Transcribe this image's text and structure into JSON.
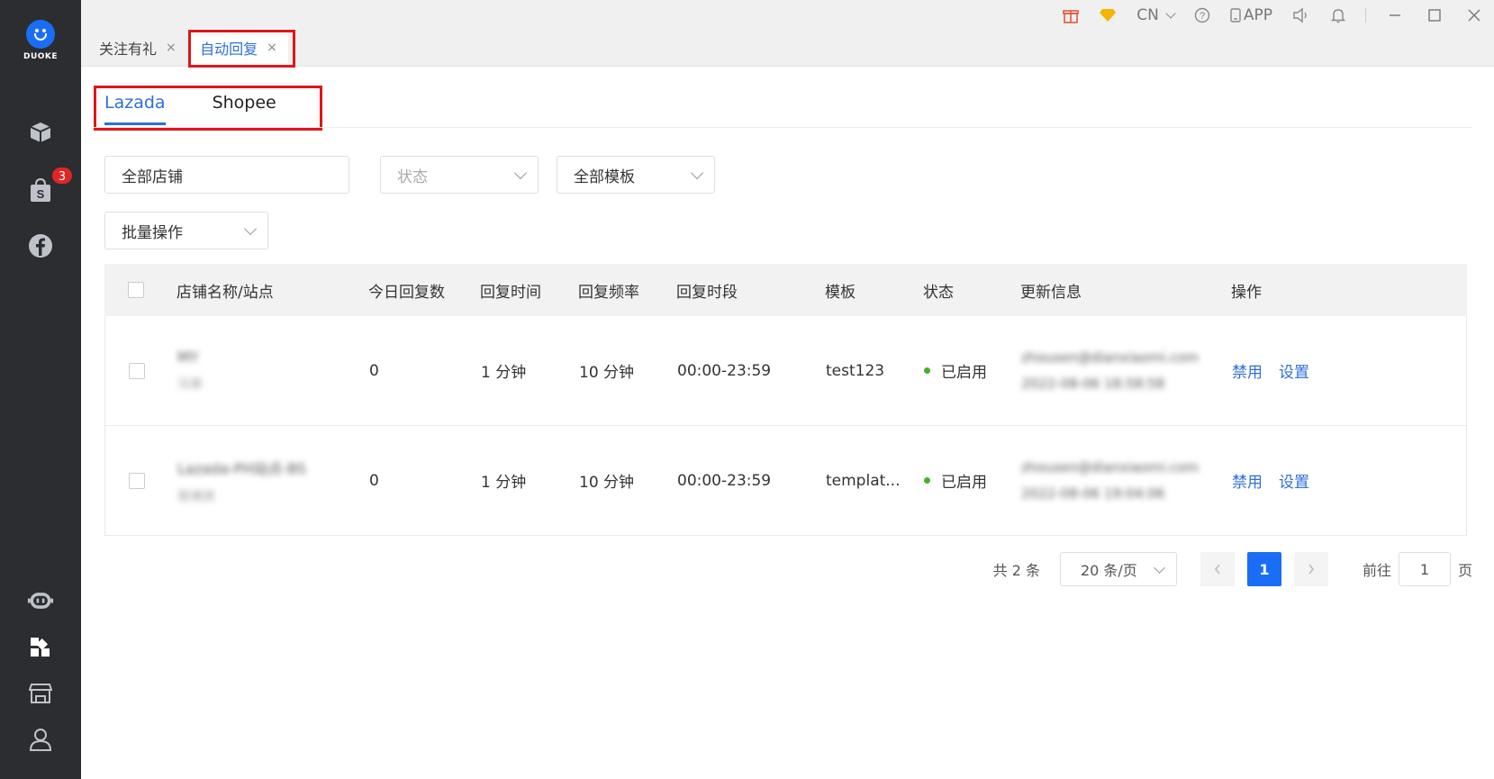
{
  "sidebar": {
    "logo_text": "DUOKE",
    "badge_count": "3",
    "icons": [
      "box-icon",
      "shopping-bag-icon",
      "facebook-icon",
      "robot-icon",
      "apps-icon",
      "store-icon",
      "user-icon"
    ]
  },
  "tabs": [
    {
      "label": "关注有礼",
      "close": "×"
    },
    {
      "label": "自动回复",
      "close": "×"
    }
  ],
  "topbar": {
    "language": "CN",
    "app_label": "APP"
  },
  "platform_tabs": [
    "Lazada",
    "Shopee"
  ],
  "filters": {
    "shop": "全部店铺",
    "status_placeholder": "状态",
    "template": "全部模板",
    "batch": "批量操作"
  },
  "table": {
    "headers": [
      "店铺名称/站点",
      "今日回复数",
      "回复时间",
      "回复频率",
      "回复时段",
      "模板",
      "状态",
      "更新信息",
      "操作"
    ],
    "rows": [
      {
        "shop_name": "MY",
        "shop_site": "马来",
        "today": "0",
        "reply_time": "1 分钟",
        "frequency": "10 分钟",
        "period": "00:00-23:59",
        "template": "test123",
        "status": "已启用",
        "update_user": "zhousen@dianxiaomi.com",
        "update_time": "2022-08-06 18:58:58",
        "op_disable": "禁用",
        "op_settings": "设置"
      },
      {
        "shop_name": "Lazada-PH站点-BS",
        "shop_site": "菲律宾",
        "today": "0",
        "reply_time": "1 分钟",
        "frequency": "10 分钟",
        "period": "00:00-23:59",
        "template": "templat...",
        "status": "已启用",
        "update_user": "zhousen@dianxiaomi.com",
        "update_time": "2022-08-06 19:04:06",
        "op_disable": "禁用",
        "op_settings": "设置"
      }
    ]
  },
  "pagination": {
    "total": "共 2 条",
    "page_size": "20 条/页",
    "current_page": "1",
    "goto_label": "前往",
    "goto_value": "1",
    "page_unit": "页"
  },
  "colors": {
    "accent": "#1a6ef5",
    "link": "#2f6fd8",
    "highlight_box": "#e0151a",
    "status_ok": "#43b02a",
    "sidebar_bg": "#2b2d30"
  }
}
